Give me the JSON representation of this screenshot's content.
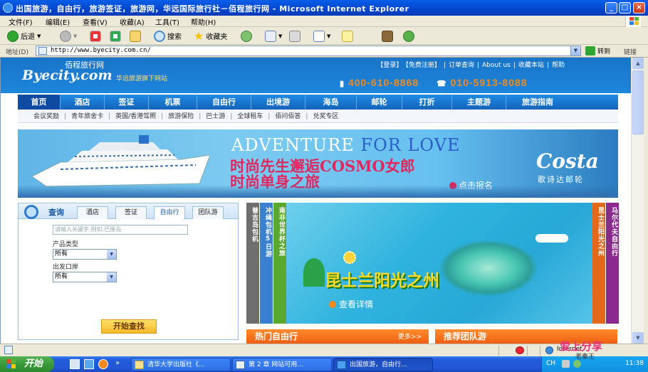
{
  "window": {
    "title": "出国旅游，自由行，旅游签证，旅游网，华远国际旅行社－佰程旅行网 - Microsoft Internet Explorer",
    "controls": [
      "_",
      "□",
      "×"
    ]
  },
  "menu": [
    "文件(F)",
    "编辑(E)",
    "查看(V)",
    "收藏(A)",
    "工具(T)",
    "帮助(H)"
  ],
  "toolbar": {
    "back": "后退",
    "search": "搜索",
    "favorites": "收藏夹"
  },
  "address": {
    "label": "地址(D)",
    "url": "http://www.byecity.com.cn/",
    "go": "转到",
    "links": "链接"
  },
  "site": {
    "logo_en": "Byecity.com",
    "logo_cn": "佰程旅行网",
    "logo_sub": "华远旅游旗下网站",
    "top_links": [
      "【登录】",
      "【免费注册】",
      "|",
      "订单查询",
      "|",
      "About us",
      "|",
      "收藏本站",
      "|",
      "帮助"
    ],
    "phone1": "400-610-8868",
    "phone2": "010-5913-8088",
    "nav": [
      "首页",
      "酒店",
      "签证",
      "机票",
      "自由行",
      "出境游",
      "海岛",
      "邮轮",
      "打折",
      "主题游",
      "旅游指南"
    ],
    "subnav": [
      "会议奖励",
      "青年旅舍卡",
      "英国/香港驾照",
      "旅游保险",
      "巴士游",
      "全球租车",
      "佰问佰答",
      "兑奖专区"
    ]
  },
  "banner": {
    "en_1": "ADVENTURE",
    "en_2": "FOR LOVE",
    "cn_1": "时尚先生邂逅COSMO女郎",
    "cn_2": "时尚单身之旅",
    "signup": "点击报名",
    "brand": "Costa",
    "brand_cn": "歌诗达邮轮"
  },
  "search": {
    "heading": "查询",
    "tabs": [
      "酒店",
      "签证",
      "自由行",
      "团队游"
    ],
    "keyword_placeholder": "请输入关键字,例如:巴厘岛",
    "type_label": "产品类型",
    "type_value": "所有",
    "port_label": "出发口岸",
    "port_value": "所有",
    "submit": "开始查找"
  },
  "promo": {
    "left_tabs": [
      "普吉岛包机",
      "冲绳包机5日游",
      "南非世界杯之旅"
    ],
    "right_tabs": [
      "昆士兰阳光之州",
      "马尔代夫自由行"
    ],
    "title": "昆士兰阳光之州",
    "more": "查看详情",
    "colors": {
      "tab1": "#6e6e6e",
      "tab2": "#3a7fd0",
      "tab3": "#58a82e",
      "tab4": "#e2681a",
      "tab5": "#8a2a8e"
    }
  },
  "sections": {
    "hot": "热门自由行",
    "hot_more": "更多>>",
    "recommend": "推荐团队游"
  },
  "statusbar": {
    "zone": "Internet"
  },
  "taskbar": {
    "start": "开始",
    "tasks": [
      "清华大学出版社《...",
      "第 2 章  网站可用...",
      "出国旅游，自由行..."
    ],
    "tray_ime": "CH",
    "time": "11:38",
    "watermark": "爱上分享",
    "watermark_sub": "老秦王"
  }
}
